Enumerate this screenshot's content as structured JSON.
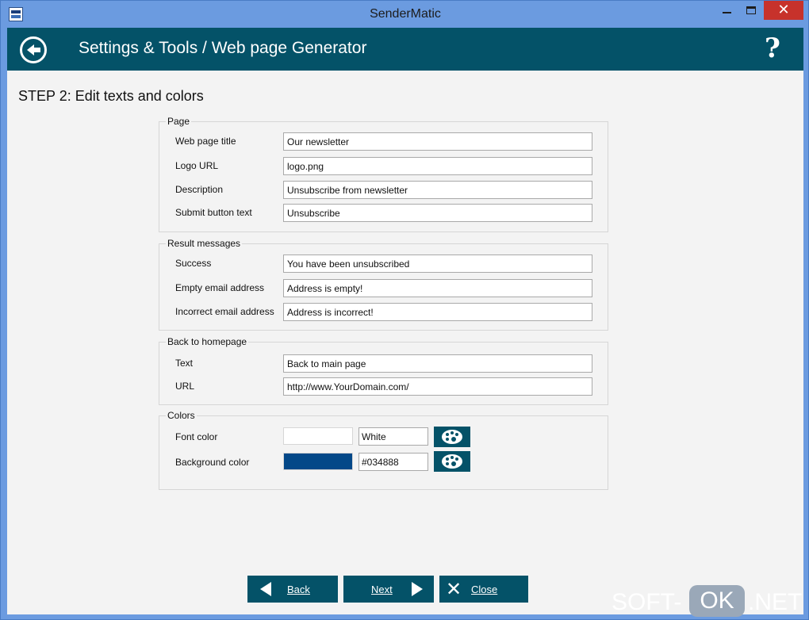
{
  "window": {
    "title": "SenderMatic",
    "close_glyph": "✕"
  },
  "header": {
    "title": "Settings & Tools / Web page Generator",
    "help": "?"
  },
  "step_title": "STEP 2: Edit texts and colors",
  "groups": {
    "page": {
      "legend": "Page",
      "rows": [
        {
          "label": "Web page title",
          "value": "Our newsletter"
        },
        {
          "label": "Logo URL",
          "value": "logo.png"
        },
        {
          "label": "Description",
          "value": "Unsubscribe from newsletter"
        },
        {
          "label": "Submit button text",
          "value": "Unsubscribe"
        }
      ]
    },
    "results": {
      "legend": "Result messages",
      "rows": [
        {
          "label": "Success",
          "value": "You have been unsubscribed"
        },
        {
          "label": "Empty email address",
          "value": "Address is empty!"
        },
        {
          "label": "Incorrect email address",
          "value": "Address is incorrect!"
        }
      ]
    },
    "back": {
      "legend": "Back to homepage",
      "rows": [
        {
          "label": "Text",
          "value": "Back to main page"
        },
        {
          "label": "URL",
          "value": "http://www.YourDomain.com/"
        }
      ]
    },
    "colors": {
      "legend": "Colors",
      "rows": [
        {
          "label": "Font color",
          "value": "White",
          "swatch": "#ffffff"
        },
        {
          "label": "Background color",
          "value": "#034888",
          "swatch": "#034888"
        }
      ]
    }
  },
  "buttons": {
    "back": "Back",
    "next": "Next",
    "close": "Close"
  },
  "watermark": {
    "prefix": "SOFT-",
    "ok": "OK",
    "suffix": ".NET"
  },
  "theme": {
    "header_bg": "#045268",
    "close_red": "#c7322b",
    "window_blue": "#6b9be0"
  }
}
